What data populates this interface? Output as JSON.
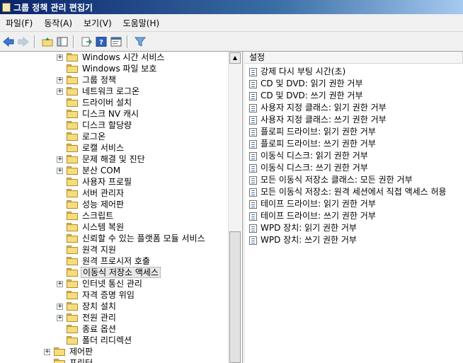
{
  "window": {
    "title": "그룹 정책 관리 편집기"
  },
  "menu": [
    "파일(F)",
    "동작(A)",
    "보기(V)",
    "도움말(H)"
  ],
  "toolbar": {
    "buttons": [
      "back-icon",
      "forward-icon",
      "up-folder-icon",
      "show-hide-tree-icon",
      "export-list-icon",
      "help-icon",
      "properties-icon",
      "filter-icon"
    ]
  },
  "tree": {
    "items": [
      {
        "label": "Windows 시간 서비스",
        "expandable": true,
        "indent": 1
      },
      {
        "label": "Windows 파일 보호",
        "expandable": false,
        "indent": 1
      },
      {
        "label": "그룹 정책",
        "expandable": true,
        "indent": 1
      },
      {
        "label": "네트워크 로그온",
        "expandable": true,
        "indent": 1
      },
      {
        "label": "드라이버 설치",
        "expandable": false,
        "indent": 1
      },
      {
        "label": "디스크 NV 캐시",
        "expandable": false,
        "indent": 1
      },
      {
        "label": "디스크 할당량",
        "expandable": false,
        "indent": 1
      },
      {
        "label": "로그온",
        "expandable": false,
        "indent": 1
      },
      {
        "label": "로캘 서비스",
        "expandable": false,
        "indent": 1
      },
      {
        "label": "문제 해결 및 진단",
        "expandable": true,
        "indent": 1
      },
      {
        "label": "분산 COM",
        "expandable": true,
        "indent": 1
      },
      {
        "label": "사용자 프로필",
        "expandable": false,
        "indent": 1
      },
      {
        "label": "서버 관리자",
        "expandable": false,
        "indent": 1
      },
      {
        "label": "성능 제어판",
        "expandable": false,
        "indent": 1
      },
      {
        "label": "스크립트",
        "expandable": false,
        "indent": 1
      },
      {
        "label": "시스템 복원",
        "expandable": false,
        "indent": 1
      },
      {
        "label": "신뢰할 수 있는 플랫폼 모듈 서비스",
        "expandable": false,
        "indent": 1
      },
      {
        "label": "원격 지원",
        "expandable": false,
        "indent": 1
      },
      {
        "label": "원격 프로시저 호출",
        "expandable": false,
        "indent": 1
      },
      {
        "label": "이동식 저장소 액세스",
        "expandable": false,
        "indent": 1,
        "selected": true
      },
      {
        "label": "인터넷 통신 관리",
        "expandable": true,
        "indent": 1
      },
      {
        "label": "자격 증명 위임",
        "expandable": false,
        "indent": 1
      },
      {
        "label": "장치 설치",
        "expandable": true,
        "indent": 1
      },
      {
        "label": "전원 관리",
        "expandable": true,
        "indent": 1
      },
      {
        "label": "종료 옵션",
        "expandable": false,
        "indent": 1
      },
      {
        "label": "폴더 리디렉션",
        "expandable": false,
        "indent": 1
      },
      {
        "label": "제어판",
        "expandable": true,
        "indent": 0
      },
      {
        "label": "프린터",
        "expandable": false,
        "indent": 0
      }
    ]
  },
  "list": {
    "column_header": "설정",
    "items": [
      "강제 다시 부팅 시간(초)",
      "CD 및 DVD: 읽기 권한 거부",
      "CD 및 DVD: 쓰기 권한 거부",
      "사용자 지정 클래스: 읽기 권한 거부",
      "사용자 지정 클래스: 쓰기 권한 거부",
      "플로피 드라이브: 읽기 권한 거부",
      "플로피 드라이브: 쓰기 권한 거부",
      "이동식 디스크: 읽기 권한 거부",
      "이동식 디스크: 쓰기 권한 거부",
      "모든 이동식 저장소 클래스: 모든 권한 거부",
      "모든 이동식 저장소: 원격 세션에서 직접 액세스 허용",
      "테이프 드라이브: 읽기 권한 거부",
      "테이프 드라이브: 쓰기 권한 거부",
      "WPD 장치: 읽기 권한 거부",
      "WPD 장치: 쓰기 권한 거부"
    ]
  },
  "colors": {
    "titlebar": "#0a246a",
    "folder": "#f6dc7c",
    "selection": "#e8e8e8"
  }
}
